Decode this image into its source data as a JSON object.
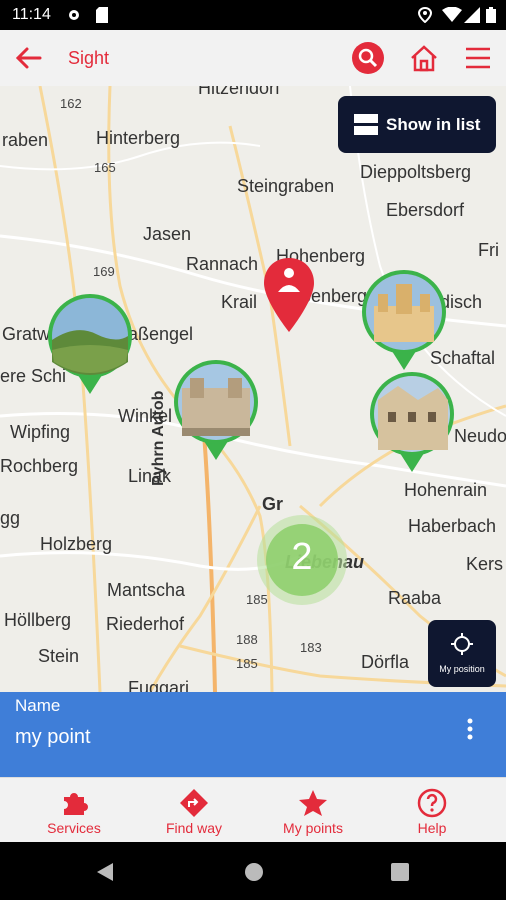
{
  "status": {
    "time": "11:14"
  },
  "appbar": {
    "title": "Sight",
    "back_icon": "back-arrow-icon",
    "search_icon": "search-icon",
    "home_icon": "home-icon",
    "menu_icon": "menu-icon"
  },
  "map": {
    "show_list_label": "Show in list",
    "my_position_label": "My position",
    "cluster_count": "2",
    "places": [
      "Hitzendorf",
      "Hinterberg",
      "Steingraben",
      "Dieppoltsberg",
      "Ebersdorf",
      "raben",
      "Jasen",
      "Rannach",
      "Hohenberg",
      "Krail",
      "Zöbenberg",
      "Fri",
      "disch",
      "Gratw",
      "aßengel",
      "Schaftal",
      "ere Schi",
      "Winkel",
      "Wipfing",
      "Neudo",
      "Rochberg",
      "Linak",
      "Hohenrain",
      "gg",
      "Haberbach",
      "Holzberg",
      "Liebenau",
      "Kers",
      "Mantscha",
      "Raaba",
      "Höllberg",
      "Riederhof",
      "Stein",
      "Dörfla",
      "Fuggari",
      "Pyhrn Autob",
      "Gr"
    ],
    "road_numbers": [
      "162",
      "165",
      "169",
      "185",
      "188",
      "183",
      "185"
    ]
  },
  "info": {
    "name_label": "Name",
    "name_value": "my point"
  },
  "bottom_nav": [
    {
      "label": "Services",
      "icon": "puzzle-icon"
    },
    {
      "label": "Find way",
      "icon": "directions-icon"
    },
    {
      "label": "My points",
      "icon": "star-icon"
    },
    {
      "label": "Help",
      "icon": "help-icon"
    }
  ],
  "colors": {
    "accent": "#e32b3b",
    "info_bar": "#3f7ed8",
    "dark_button": "#0f1730",
    "pin_green": "#3bb34a"
  }
}
